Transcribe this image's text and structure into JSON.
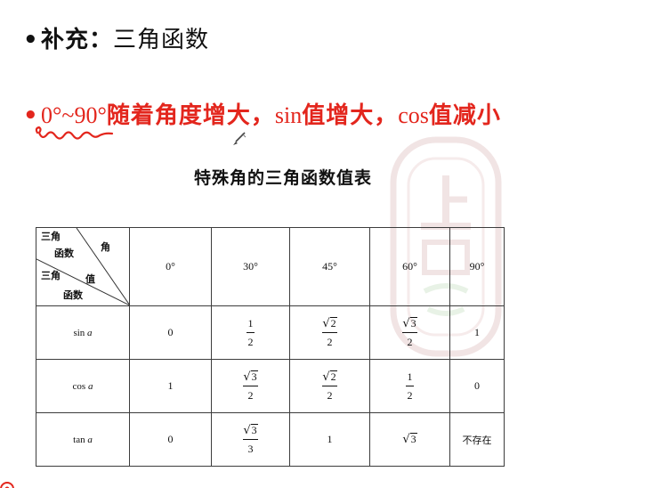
{
  "slide": {
    "bullet1": {
      "marker": "•",
      "label": "补充：",
      "text": "三角函数"
    },
    "bullet2": {
      "marker": "•",
      "segments": [
        "0°~90°",
        "随着角度增大，",
        "sin",
        "值增大，",
        "cos",
        "值减小"
      ]
    }
  },
  "table": {
    "title": "特殊角的三角函数值表",
    "header_cell": {
      "top_left": "三角",
      "top_left_2": "函数",
      "top_right": "角",
      "mid_left": "三角",
      "mid_right": "值",
      "bottom": "函数"
    },
    "columns": [
      "0°",
      "30°",
      "45°",
      "60°",
      "90°"
    ],
    "rows": [
      {
        "fn": "sin",
        "var": "a",
        "values": [
          "0",
          {
            "num": "1",
            "den": "2"
          },
          {
            "num": "√2",
            "den": "2"
          },
          {
            "num": "√3",
            "den": "2"
          },
          "1"
        ]
      },
      {
        "fn": "cos",
        "var": "a",
        "values": [
          "1",
          {
            "num": "√3",
            "den": "2"
          },
          {
            "num": "√2",
            "den": "2"
          },
          {
            "num": "1",
            "den": "2"
          },
          "0"
        ]
      },
      {
        "fn": "tan",
        "var": "a",
        "values": [
          "0",
          {
            "num": "√3",
            "den": "3"
          },
          "1",
          "√3",
          "不存在"
        ]
      }
    ]
  },
  "icons": {
    "squiggle": "hand-drawn-underline-icon",
    "cursor": "pen-cursor-icon",
    "watermark": "seal-watermark-icon",
    "bottom": "annotation-icon"
  },
  "colors": {
    "accent_red": "#e3261d",
    "text": "#111111",
    "table_border": "#3c3c3c",
    "watermark": "#e6cfcf"
  }
}
